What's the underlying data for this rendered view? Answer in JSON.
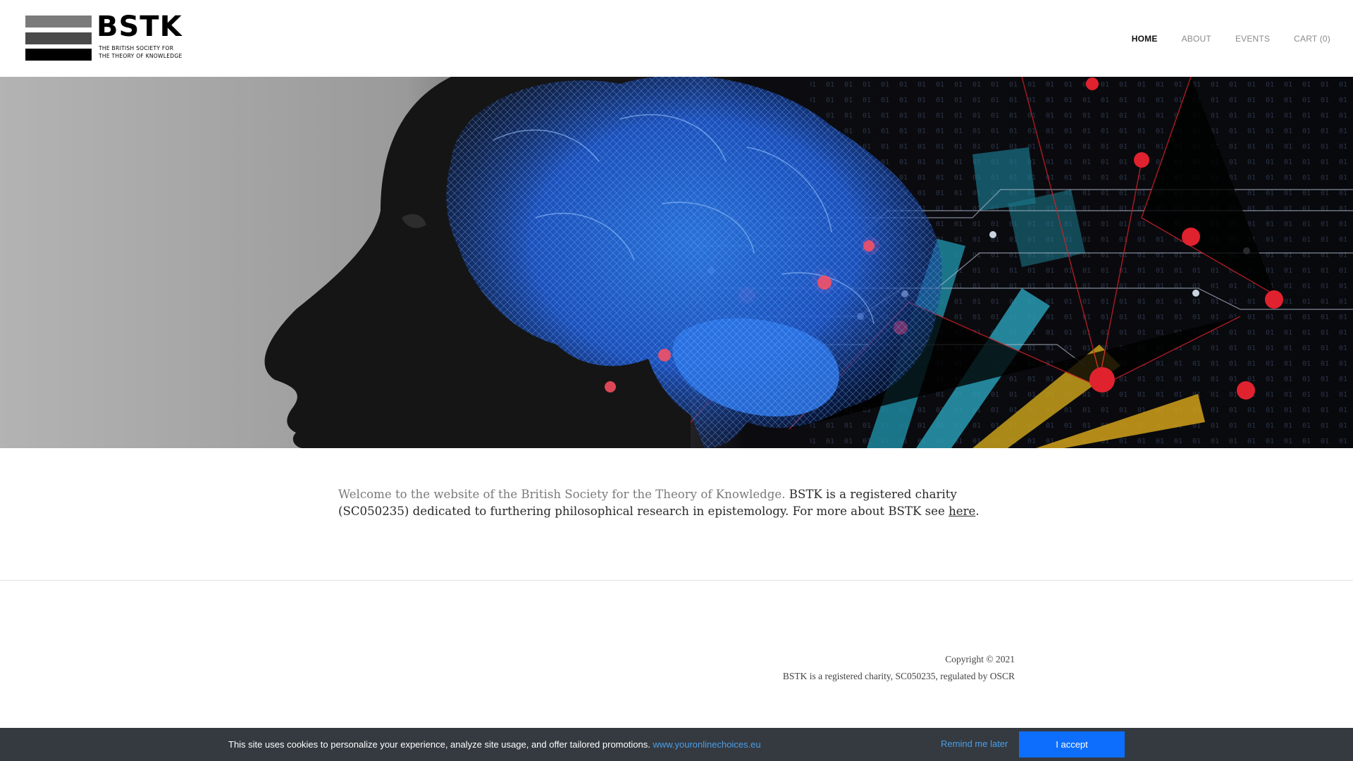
{
  "logo": {
    "wordmark": "BSTK",
    "line1": "THE BRITISH SOCIETY  FOR",
    "line2": "THE THEORY OF KNOWLEDGE"
  },
  "nav": [
    {
      "label": "HOME",
      "active": true
    },
    {
      "label": "ABOUT",
      "active": false
    },
    {
      "label": "EVENTS",
      "active": false
    },
    {
      "label": "CART (0)",
      "active": false
    }
  ],
  "hero": {
    "image": "profile silhouette with glowing blue wireframe brain and circuit network"
  },
  "intro": {
    "lead": "Welcome to the website of the British Society for the Theory of Knowledge.",
    "body": " BSTK is a registered charity (SC050235) dedicated to furthering philosophical research in epistemology. For more about BSTK see ",
    "link": "here",
    "end": "."
  },
  "footer": {
    "copyright": "Copyright © 2021",
    "charity": "BSTK is a registered charity,  SC050235, regulated by OSCR"
  },
  "cookie": {
    "message": "This site uses cookies to personalize your experience, analyze site usage, and offer tailored promotions. ",
    "link": "www.youronlinechoices.eu",
    "remind": "Remind me later",
    "accept": "I accept"
  },
  "colors": {
    "cookie_bg": "#343a40",
    "accent_blue": "#0d6efd",
    "link_blue": "#4c9ee8"
  }
}
